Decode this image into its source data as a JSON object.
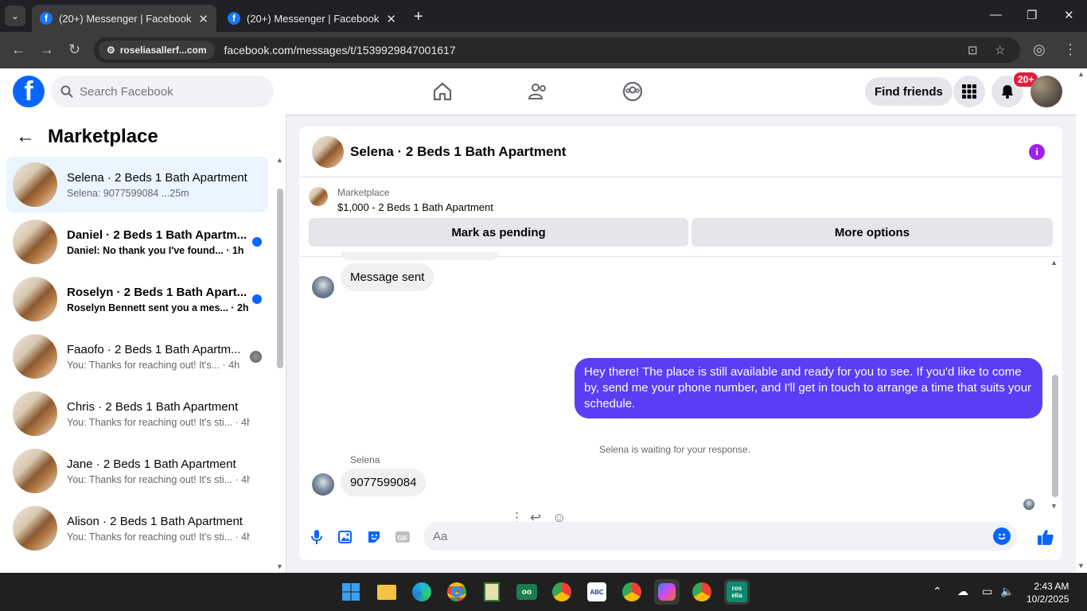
{
  "browser": {
    "tabs": [
      {
        "title": "(20+) Messenger | Facebook",
        "active": true
      },
      {
        "title": "(20+) Messenger | Facebook",
        "active": false
      }
    ],
    "site_chip": "roseliasallerf...com",
    "url": "facebook.com/messages/t/1539929847001617"
  },
  "header": {
    "search_placeholder": "Search Facebook",
    "find_friends": "Find friends",
    "notif_badge": "20+"
  },
  "sidebar": {
    "title": "Marketplace",
    "conversations": [
      {
        "name": "Selena · 2 Beds 1 Bath Apartment",
        "preview": "Selena: 9077599084 ...25m",
        "selected": true,
        "unread": false,
        "status": "none"
      },
      {
        "name": "Daniel · 2 Beds 1 Bath Apartm...",
        "preview": "Daniel: No thank you I've found... · 1h",
        "selected": false,
        "unread": true,
        "status": "dot"
      },
      {
        "name": "Roselyn · 2 Beds 1 Bath Apart...",
        "preview": "Roselyn Bennett sent you a mes... · 2h",
        "selected": false,
        "unread": true,
        "status": "dot"
      },
      {
        "name": "Faaofo · 2 Beds 1 Bath Apartm...",
        "preview": "You: Thanks for reaching out! It's... · 4h",
        "selected": false,
        "unread": false,
        "status": "seen"
      },
      {
        "name": "Chris · 2 Beds 1 Bath Apartment",
        "preview": "You: Thanks for reaching out! It's sti... · 4h",
        "selected": false,
        "unread": false,
        "status": "none"
      },
      {
        "name": "Jane · 2 Beds 1 Bath Apartment",
        "preview": "You: Thanks for reaching out! It's sti... · 4h",
        "selected": false,
        "unread": false,
        "status": "none"
      },
      {
        "name": "Alison · 2 Beds 1 Bath Apartment",
        "preview": "You: Thanks for reaching out! It's sti... · 4h",
        "selected": false,
        "unread": false,
        "status": "none"
      }
    ]
  },
  "chat": {
    "title": "Selena · 2 Beds 1 Bath Apartment",
    "listing_label": "Marketplace",
    "listing_price": "$1,000 - 2 Beds 1 Bath Apartment",
    "mark_pending": "Mark as pending",
    "more_options": "More options",
    "msg_sent": "Message sent",
    "system_msg": "Selena is waiting for your response.",
    "my_message": "Hey there! The place is still available and ready for you to see. If you'd like to come by, send me your phone number, and I'll get in touch to arrange a time that suits your schedule.",
    "sender_name": "Selena",
    "reply": "9077599084",
    "composer_placeholder": "Aa"
  },
  "taskbar": {
    "time": "2:43 AM",
    "date": "10/2/2025"
  },
  "colors": {
    "fb_blue": "#0866ff",
    "my_bubble": "#5b3df5",
    "selected_conv": "#ebf5ff",
    "info_purple": "#a020f0"
  }
}
